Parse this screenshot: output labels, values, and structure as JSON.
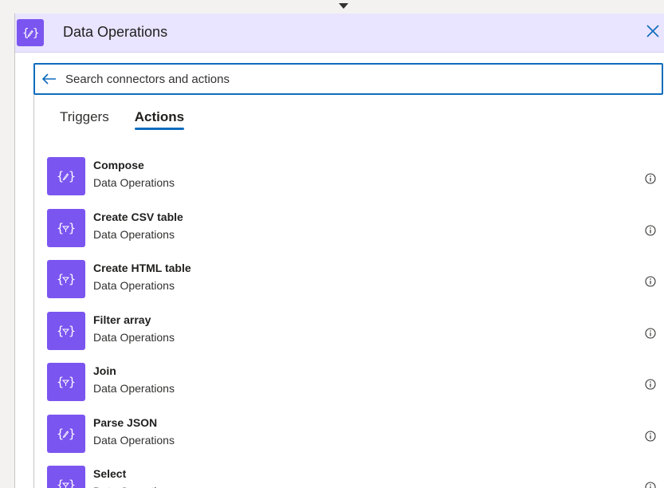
{
  "panel": {
    "title": "Data Operations",
    "icon": "braces-pencil-icon",
    "close_icon": "close-icon"
  },
  "search": {
    "placeholder": "Search connectors and actions",
    "value": ""
  },
  "tabs": [
    {
      "label": "Triggers",
      "active": false
    },
    {
      "label": "Actions",
      "active": true
    }
  ],
  "actions": [
    {
      "name": "Compose",
      "connector": "Data Operations",
      "icon": "braces-pencil-icon"
    },
    {
      "name": "Create CSV table",
      "connector": "Data Operations",
      "icon": "braces-filter-icon"
    },
    {
      "name": "Create HTML table",
      "connector": "Data Operations",
      "icon": "braces-filter-icon"
    },
    {
      "name": "Filter array",
      "connector": "Data Operations",
      "icon": "braces-filter-icon"
    },
    {
      "name": "Join",
      "connector": "Data Operations",
      "icon": "braces-filter-icon"
    },
    {
      "name": "Parse JSON",
      "connector": "Data Operations",
      "icon": "braces-pencil-icon"
    },
    {
      "name": "Select",
      "connector": "Data Operations",
      "icon": "braces-filter-icon"
    }
  ],
  "colors": {
    "accent": "#7b55f0",
    "header_bg": "#e9e4ff",
    "focus_blue": "#0f6cbd"
  }
}
